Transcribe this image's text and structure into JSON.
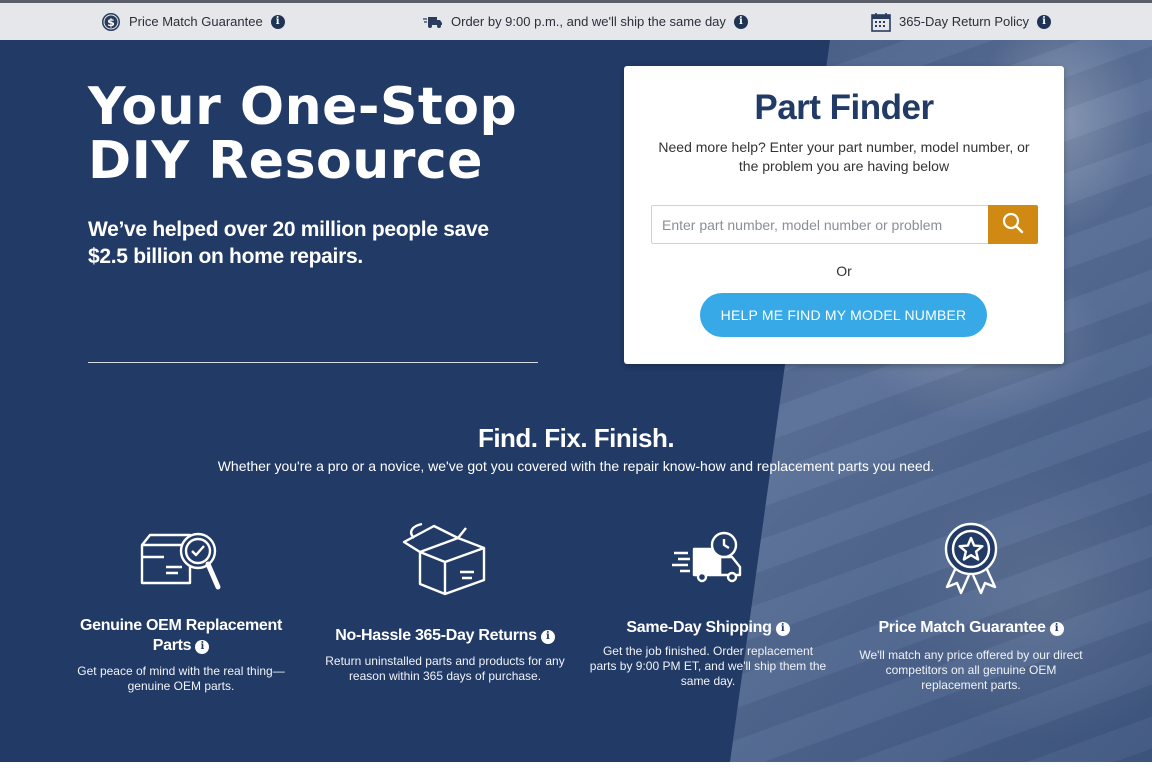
{
  "topbar": {
    "items": [
      {
        "icon": "dollar-coin-icon",
        "label": "Price Match Guarantee"
      },
      {
        "icon": "shipping-truck-icon",
        "label": "Order by 9:00 p.m., and we'll ship the same day"
      },
      {
        "icon": "calendar-icon",
        "label": "365-Day Return Policy"
      }
    ],
    "info_glyph": "i"
  },
  "hero": {
    "title": "Your One-Stop DIY Resource",
    "subtitle": "We’ve helped over 20 million people save $2.5 billion on home repairs."
  },
  "finder": {
    "title": "Part Finder",
    "description": "Need more help? Enter your part number, model number, or the problem you are having below",
    "search_placeholder": "Enter part number, model number or problem",
    "search_value": "",
    "or_text": "Or",
    "model_button": "HELP ME FIND MY MODEL NUMBER",
    "accent_color": "#d08a14",
    "button_color": "#36a9e6"
  },
  "section": {
    "title": "Find. Fix. Finish.",
    "subtitle": "Whether you're a pro or a novice, we've got you covered with the repair know-how and replacement parts you need."
  },
  "features": [
    {
      "icon": "box-magnifier-icon",
      "title": "Genuine OEM Replacement Parts",
      "desc": "Get peace of mind with the real thing—genuine OEM parts."
    },
    {
      "icon": "open-box-return-icon",
      "title": "No-Hassle 365-Day Returns",
      "desc": "Return uninstalled parts and products for any reason within 365 days of purchase."
    },
    {
      "icon": "fast-delivery-truck-icon",
      "title": "Same-Day Shipping",
      "desc": "Get the job finished. Order replacement parts by 9:00 PM ET, and we'll ship them the same day."
    },
    {
      "icon": "award-ribbon-icon",
      "title": "Price Match Guarantee",
      "desc": "We'll match any price offered by our direct competitors on all genuine OEM replacement parts."
    }
  ],
  "colors": {
    "hero_bg": "#213a66",
    "topbar_bg": "#e6e7ea"
  }
}
